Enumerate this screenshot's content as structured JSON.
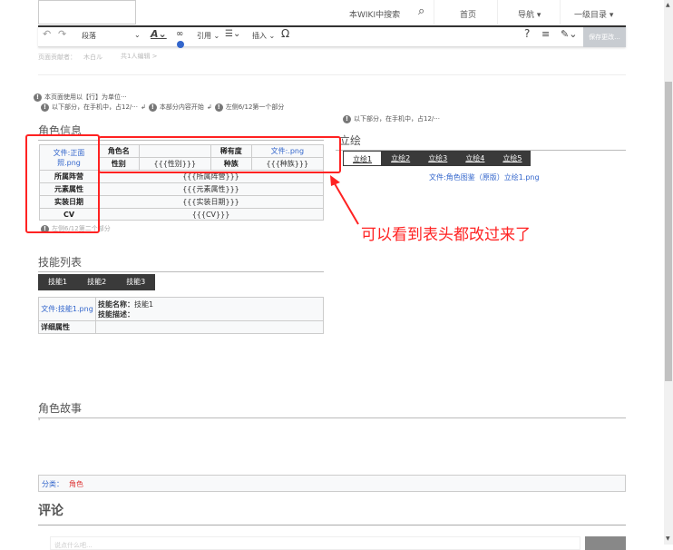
{
  "header": {
    "search_placeholder": "本WIKI中搜索",
    "nav": [
      "首页",
      "导航 ▾",
      "一级目录 ▾"
    ]
  },
  "toolbar": {
    "paragraph": "段落",
    "cite": "引用",
    "insert": "插入",
    "save": "保存更改..."
  },
  "contributors": {
    "label": "页面贡献者：",
    "user": "木白ル",
    "count": "共1人编辑 >"
  },
  "notices": {
    "row_unit": "本页面使用以【行】为单位···",
    "mobile": "以下部分，在手机中，占12/···",
    "section_start": "本部分内容开始",
    "left_first": "左侧6/12第一个部分",
    "right_mobile": "以下部分，在手机中，占12/···",
    "left_second": "左侧6/12第二个部分"
  },
  "info": {
    "heading": "角色信息",
    "portrait": "文件:正面照.png",
    "name_label": "角色名",
    "name_value": "",
    "rarity_label": "稀有度",
    "rarity_value": "文件:.png",
    "gender_label": "性别",
    "gender_value": "{{{性别}}}",
    "race_label": "种族",
    "race_value": "{{{种族}}}",
    "rows": [
      {
        "label": "所属阵营",
        "value": "{{{所属阵营}}}"
      },
      {
        "label": "元素属性",
        "value": "{{{元素属性}}}"
      },
      {
        "label": "实装日期",
        "value": "{{{实装日期}}}"
      },
      {
        "label": "CV",
        "value": "{{{CV}}}"
      }
    ]
  },
  "art": {
    "heading": "立绘",
    "tabs": [
      "立绘1",
      "立绘2",
      "立绘3",
      "立绘4",
      "立绘5"
    ],
    "file": "文件:角色图鉴（原版）立绘1.png"
  },
  "annotation": "可以看到表头都改过来了",
  "skills": {
    "heading": "技能列表",
    "tabs": [
      "技能1",
      "技能2",
      "技能3"
    ],
    "file": "文件:技能1.png",
    "name_label": "技能名称：",
    "name_value": "技能1",
    "desc_label": "技能描述：",
    "detail_label": "详细属性"
  },
  "story": {
    "heading": "角色故事",
    "text": "'"
  },
  "category": {
    "label": "分类：",
    "value": "角色"
  },
  "comments": {
    "heading": "评论",
    "placeholder": "说点什么吧..."
  },
  "colors": {
    "accent": "#3366cc",
    "annotation": "#ff2222",
    "tab_bg": "#3a3a3a"
  }
}
